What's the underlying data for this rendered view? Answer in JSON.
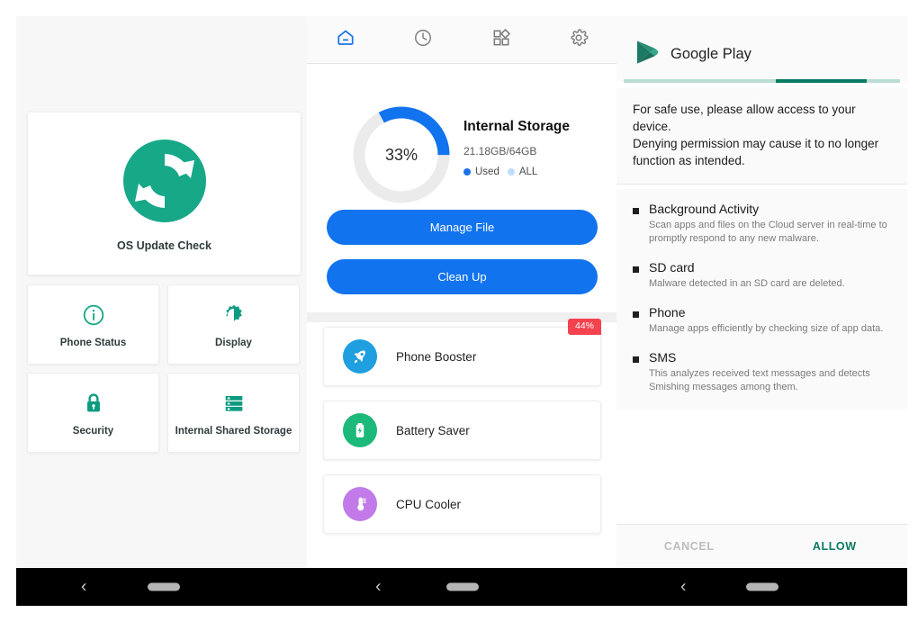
{
  "theme": {
    "teal": "#17a888",
    "blue": "#1a73e8",
    "blue_bright": "#1273ef",
    "light_blue": "#bfdcfb",
    "red": "#f4424f",
    "green": "#1db97a",
    "purple": "#c27ae8",
    "play_green": "#0a7a63",
    "panel_bg": "#f7f7f7"
  },
  "left_panel": {
    "hero": {
      "icon": "refresh-sync-icon",
      "label": "OS Update Check"
    },
    "tiles": [
      {
        "icon": "info-circle-icon",
        "label": "Phone Status"
      },
      {
        "icon": "brightness-icon",
        "label": "Display"
      },
      {
        "icon": "lock-icon",
        "label": "Security"
      },
      {
        "icon": "storage-server-icon",
        "label": "Internal Shared Storage"
      }
    ],
    "navbar": {
      "back": "back-icon",
      "home": "home-pill-icon"
    }
  },
  "middle_panel": {
    "tabs": [
      {
        "icon": "home-icon",
        "active": true
      },
      {
        "icon": "clock-history-icon",
        "active": false
      },
      {
        "icon": "apps-grid-icon",
        "active": false
      },
      {
        "icon": "gear-settings-icon",
        "active": false
      }
    ],
    "storage": {
      "percent_label": "33%",
      "percent_value": 33,
      "title": "Internal Storage",
      "subtitle": "21.18GB/64GB",
      "legend": [
        {
          "label": "Used",
          "color": "#1a73e8"
        },
        {
          "label": "ALL",
          "color": "#bfdcfb"
        }
      ]
    },
    "buttons": {
      "manage": "Manage File",
      "cleanup": "Clean Up"
    },
    "tools": [
      {
        "icon": "rocket-booster-icon",
        "label": "Phone Booster",
        "badge": "44%",
        "color": "#1f9fe0"
      },
      {
        "icon": "battery-icon",
        "label": "Battery Saver",
        "badge": null,
        "color": "#1db97a"
      },
      {
        "icon": "thermometer-icon",
        "label": "CPU Cooler",
        "badge": null,
        "color": "#c27ae8"
      }
    ],
    "navbar": {
      "back": "back-icon",
      "home": "home-pill-icon"
    }
  },
  "right_panel": {
    "app_name": "Google Play",
    "app_icon": "google-play-icon",
    "progress": {
      "start_percent": 55,
      "end_percent": 88
    },
    "message_line1": "For safe use, please allow access to your device.",
    "message_line2": "Denying permission may cause it to no longer function as intended.",
    "permissions": [
      {
        "title": "Background Activity",
        "desc": "Scan apps and files on the Cloud server in real-time to promptly respond to any new malware."
      },
      {
        "title": "SD card",
        "desc": "Malware detected in an SD card are deleted."
      },
      {
        "title": "Phone",
        "desc": "Manage apps efficiently by checking size of app data."
      },
      {
        "title": "SMS",
        "desc": "This analyzes received text messages and detects Smishing messages among them."
      }
    ],
    "actions": {
      "cancel": "CANCEL",
      "allow": "ALLOW"
    },
    "navbar": {
      "back": "back-icon",
      "home": "home-pill-icon"
    }
  }
}
